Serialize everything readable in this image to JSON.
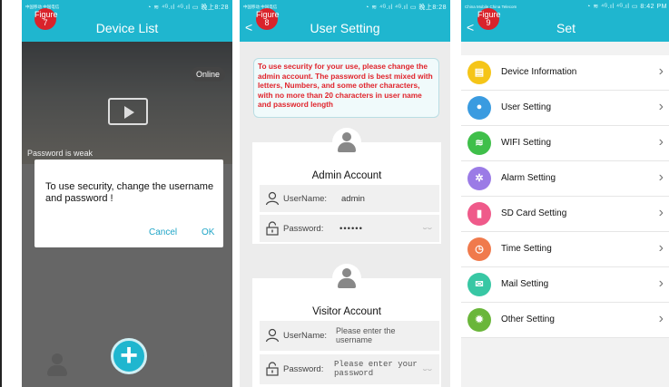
{
  "phone1": {
    "status_left": "中国移动\n中国电信",
    "status_right": "◔ ≋ ⁴ᴳ.ıl ⁴ᴳ.ıl ▭ 晚上8:28",
    "figure_badge": "Figure 7",
    "title": "Device List",
    "online_badge": "Online",
    "weak_notice": "Password is weak",
    "dialog_message": "To use security, change the username and password !",
    "cancel_label": "Cancel",
    "ok_label": "OK",
    "icons": [
      "user-icon",
      "add-icon",
      "user-settings-icon"
    ]
  },
  "phone2": {
    "status_left": "中国移动\n中国电信",
    "status_right": "◔ ≋ ⁴ᴳ.ıl ⁴ᴳ.ıl ▭ 晚上8:28",
    "figure_badge": "Figure 8",
    "title": "User Setting",
    "notice": "To use security for your use, please change the admin account. The password is best mixed with letters, Numbers, and some other characters, with no more than 20 characters in user name and password length",
    "admin": {
      "title": "Admin Account",
      "username_label": "UserName:",
      "username_value": "admin",
      "password_label": "Password:",
      "password_value": "••••••"
    },
    "visitor": {
      "title": "Visitor Account",
      "username_label": "UserName:",
      "username_placeholder": "Please enter the username",
      "password_label": "Password:",
      "password_placeholder": "Please enter your password"
    }
  },
  "phone3": {
    "status_left": "China Mobile\nChina Telecom",
    "status_right": "◔ ≋ ⁴ᴳ.ıl ⁴ᴳ.ıl ▭ 8:42 PM",
    "figure_badge": "Figure 9",
    "title": "Set",
    "items": [
      {
        "label": "Device Information",
        "icon": "device-info-icon",
        "color": "#f5c518",
        "glyph": "▤"
      },
      {
        "label": "User Setting",
        "icon": "user-icon",
        "color": "#3a9be0",
        "glyph": "●"
      },
      {
        "label": "WIFI Setting",
        "icon": "wifi-icon",
        "color": "#3fbf4a",
        "glyph": "≋"
      },
      {
        "label": "Alarm Setting",
        "icon": "alarm-icon",
        "color": "#9b7be6",
        "glyph": "✲"
      },
      {
        "label": "SD Card Setting",
        "icon": "sd-card-icon",
        "color": "#ef5a8a",
        "glyph": "▮"
      },
      {
        "label": "Time Setting",
        "icon": "clock-icon",
        "color": "#f07a4c",
        "glyph": "◷"
      },
      {
        "label": "Mail Setting",
        "icon": "mail-icon",
        "color": "#38c7a4",
        "glyph": "✉"
      },
      {
        "label": "Other Setting",
        "icon": "gear-icon",
        "color": "#6ab63a",
        "glyph": "✹"
      }
    ]
  }
}
